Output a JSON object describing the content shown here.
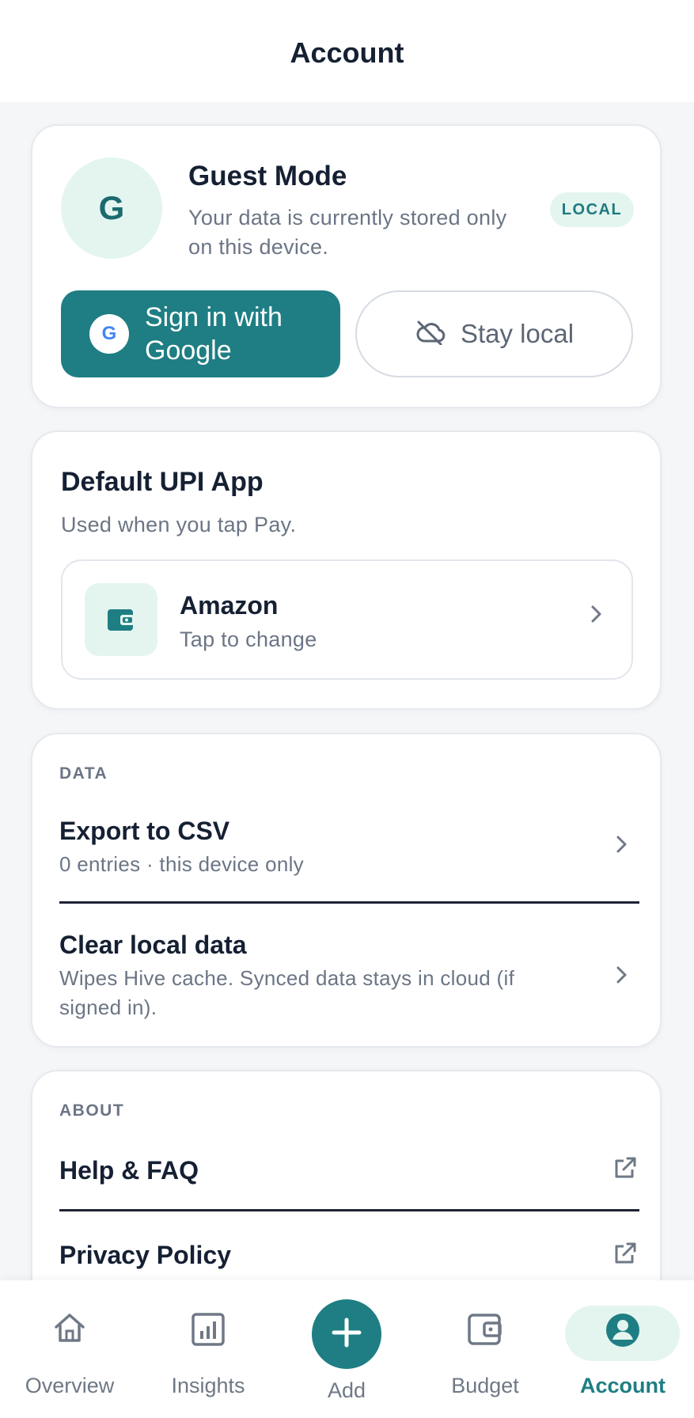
{
  "header": {
    "title": "Account"
  },
  "guest": {
    "avatar_letter": "G",
    "title": "Guest Mode",
    "description": "Your data is currently stored only on this device.",
    "badge": "LOCAL",
    "google_icon_letter": "G",
    "google_button": "Sign in with Google",
    "local_button": "Stay local",
    "local_icon": "cloud-off-icon"
  },
  "upi": {
    "title": "Default UPI App",
    "subtitle": "Used when you tap Pay.",
    "app_name": "Amazon",
    "app_hint": "Tap to change",
    "app_icon": "wallet-icon"
  },
  "data_section": {
    "overline": "DATA",
    "export_title": "Export to CSV",
    "export_sub": "0 entries · this device only",
    "clear_title": "Clear local data",
    "clear_sub": "Wipes Hive cache. Synced data stays in cloud (if signed in)."
  },
  "about_section": {
    "overline": "ABOUT",
    "help": "Help & FAQ",
    "privacy": "Privacy Policy"
  },
  "nav": {
    "overview": "Overview",
    "insights": "Insights",
    "add": "Add",
    "budget": "Budget",
    "account": "Account",
    "active": "Account"
  },
  "colors": {
    "accent": "#1e7e83",
    "accent_soft": "#e4f5ef",
    "text_primary": "#152033",
    "text_secondary": "#6b7585"
  }
}
